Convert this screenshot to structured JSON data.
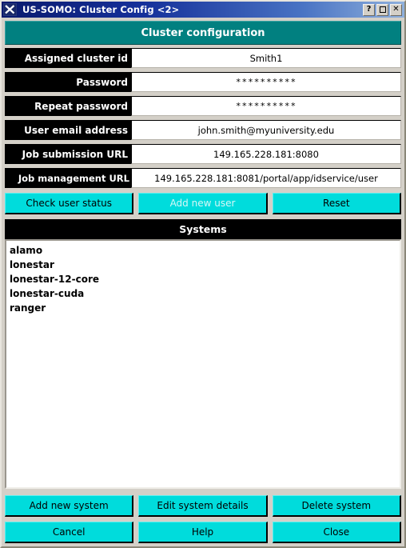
{
  "window": {
    "title": "US-SOMO: Cluster Config <2>",
    "app_icon": "x11-app-icon",
    "controls": {
      "help": "?",
      "maximize": "maximize-glyph",
      "close": "✕"
    }
  },
  "banner": {
    "title": "Cluster configuration"
  },
  "form": {
    "fields": [
      {
        "label": "Assigned cluster id",
        "value": "Smith1",
        "masked": false,
        "name": "assigned-cluster-id"
      },
      {
        "label": "Password",
        "value": "**********",
        "masked": true,
        "name": "password"
      },
      {
        "label": "Repeat password",
        "value": "**********",
        "masked": true,
        "name": "repeat-password"
      },
      {
        "label": "User email address",
        "value": "john.smith@myuniversity.edu",
        "masked": false,
        "name": "user-email-address"
      },
      {
        "label": "Job submission URL",
        "value": "149.165.228.181:8080",
        "masked": false,
        "name": "job-submission-url"
      },
      {
        "label": "Job management URL",
        "value": "149.165.228.181:8081/portal/app/idservice/user",
        "masked": false,
        "name": "job-management-url"
      }
    ]
  },
  "user_actions": [
    {
      "label": "Check user status",
      "enabled": true,
      "name": "check-user-status-button"
    },
    {
      "label": "Add new user",
      "enabled": false,
      "name": "add-new-user-button"
    },
    {
      "label": "Reset",
      "enabled": true,
      "name": "reset-button"
    }
  ],
  "systems": {
    "header": "Systems",
    "items": [
      "alamo",
      "lonestar",
      "lonestar-12-core",
      "lonestar-cuda",
      "ranger"
    ]
  },
  "system_actions": [
    {
      "label": "Add new system",
      "enabled": true,
      "name": "add-new-system-button"
    },
    {
      "label": "Edit system details",
      "enabled": true,
      "name": "edit-system-details-button"
    },
    {
      "label": "Delete system",
      "enabled": true,
      "name": "delete-system-button"
    }
  ],
  "dialog_actions": [
    {
      "label": "Cancel",
      "enabled": true,
      "name": "cancel-button"
    },
    {
      "label": "Help",
      "enabled": true,
      "name": "help-button"
    },
    {
      "label": "Close",
      "enabled": true,
      "name": "close-button"
    }
  ],
  "colors": {
    "banner_teal": "#018080",
    "button_cyan": "#00dcdc",
    "window_face": "#d4d0c8",
    "label_bg": "#000000",
    "titlebar_start": "#0a1a6e",
    "titlebar_end": "#8fb0dc"
  }
}
